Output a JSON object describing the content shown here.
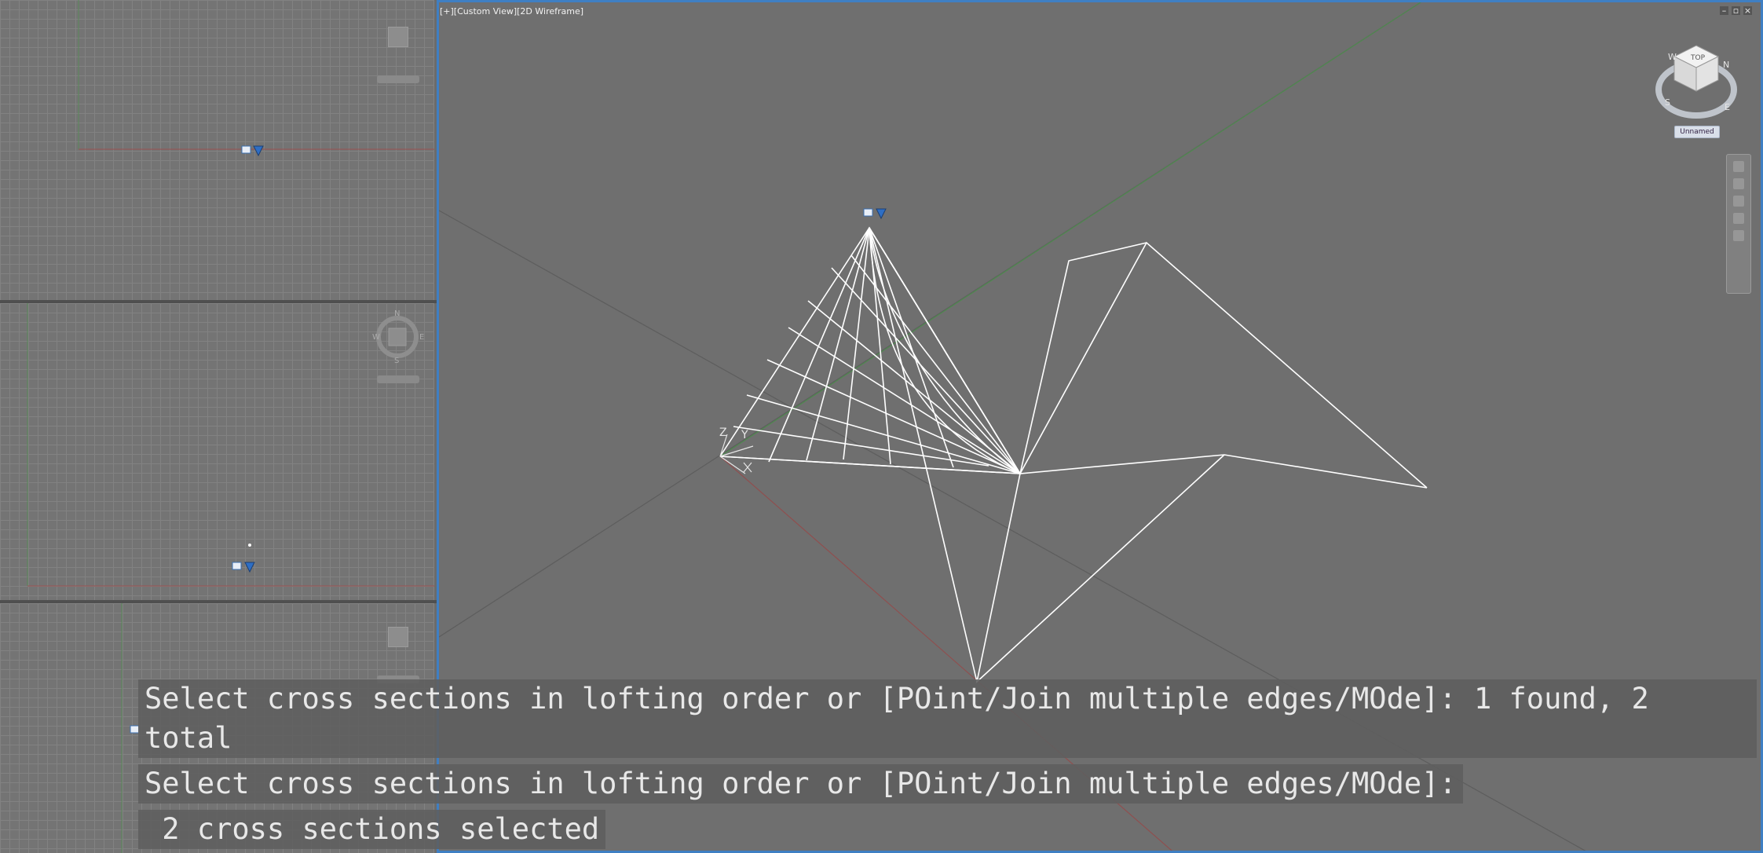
{
  "viewport": {
    "label": "[+][Custom View][2D Wireframe]",
    "window_buttons": [
      "–",
      "▫",
      "×"
    ]
  },
  "viewcube": {
    "face_label": "TOP",
    "compass": {
      "n": "N",
      "s": "S",
      "e": "E",
      "w": "W"
    },
    "ucs_menu": "Unnamed"
  },
  "side_compass": {
    "n": "N",
    "s": "S",
    "e": "E",
    "w": "W"
  },
  "axis_labels": {
    "x": "X",
    "y": "Y",
    "z": "Z"
  },
  "command_history": {
    "line1": "Select cross sections in lofting order or [POint/Join multiple edges/MOde]: 1 found, 2 total",
    "line2": "Select cross sections in lofting order or [POint/Join multiple edges/MOde]:",
    "line3": " 2 cross sections selected"
  },
  "colors": {
    "background": "#6f6f6f",
    "active_border": "#3f7fc3",
    "wireframe": "#ffffff",
    "x_axis": "#9a4a4a",
    "y_axis": "#4a8a4a"
  },
  "icons": [
    "ucs-icon",
    "viewcube-icon",
    "navigation-bar-icon",
    "minimize-icon",
    "restore-icon",
    "close-icon"
  ]
}
